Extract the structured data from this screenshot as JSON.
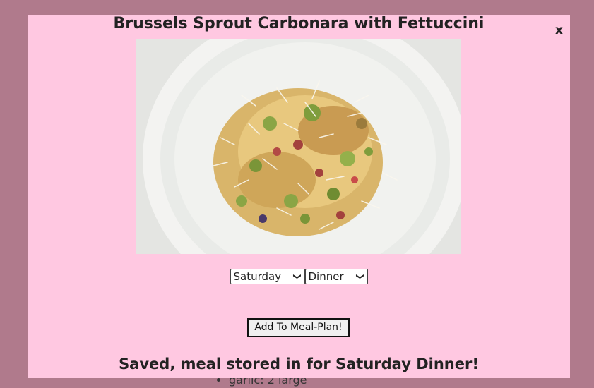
{
  "background_list": {
    "items": [
      "garlic: 2 large"
    ]
  },
  "modal": {
    "close_label": "x",
    "title": "Brussels Sprout Carbonara with Fettuccini",
    "image_alt": "Plate of fettuccine with brussels sprouts, pancetta and grated cheese",
    "day_select": {
      "selected": "Saturday",
      "options": [
        "Saturday"
      ]
    },
    "meal_select": {
      "selected": "Dinner",
      "options": [
        "Dinner"
      ]
    },
    "add_button_label": "Add To Meal-Plan!",
    "status_message": "Saved, meal stored in for Saturday Dinner!"
  },
  "colors": {
    "overlay": "#b07a8c",
    "modal_bg": "#ffc8e1"
  },
  "icons": [
    "close-icon",
    "chevron-down-icon"
  ]
}
